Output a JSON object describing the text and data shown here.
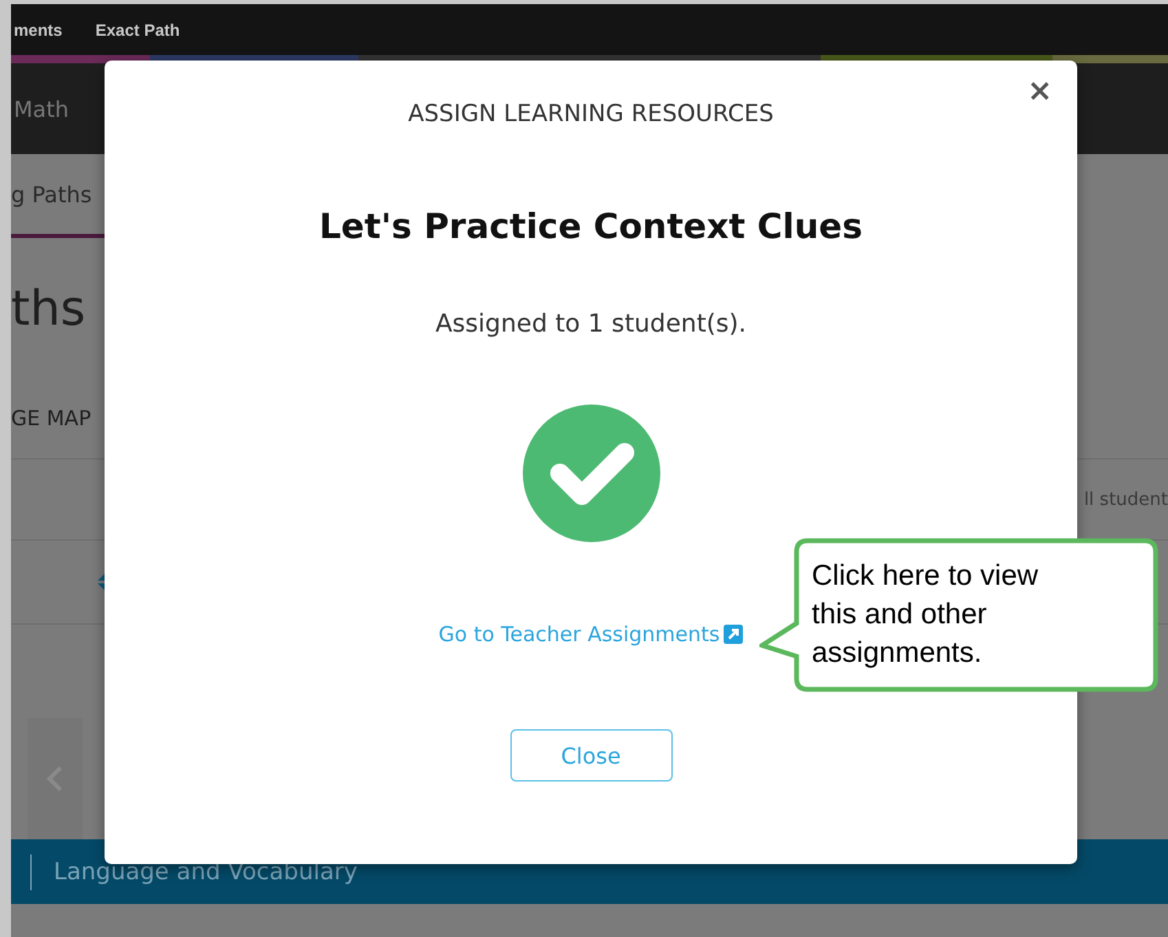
{
  "background_page": {
    "top_bar_links": [
      "ments",
      "Exact Path"
    ],
    "nav_label": "Math",
    "tab": "g Paths",
    "heading": "ths",
    "section_tab": "GE MAP",
    "column_text": "ll student",
    "banner": "Language and Vocabulary"
  },
  "modal": {
    "title": "ASSIGN LEARNING RESOURCES",
    "close_icon": "×",
    "heading": "Let's Practice Context Clues",
    "message": "Assigned to 1 student(s).",
    "link": "Go to Teacher Assignments",
    "close_button": "Close"
  },
  "callout": {
    "text": "Click here to view this and other assignments."
  }
}
